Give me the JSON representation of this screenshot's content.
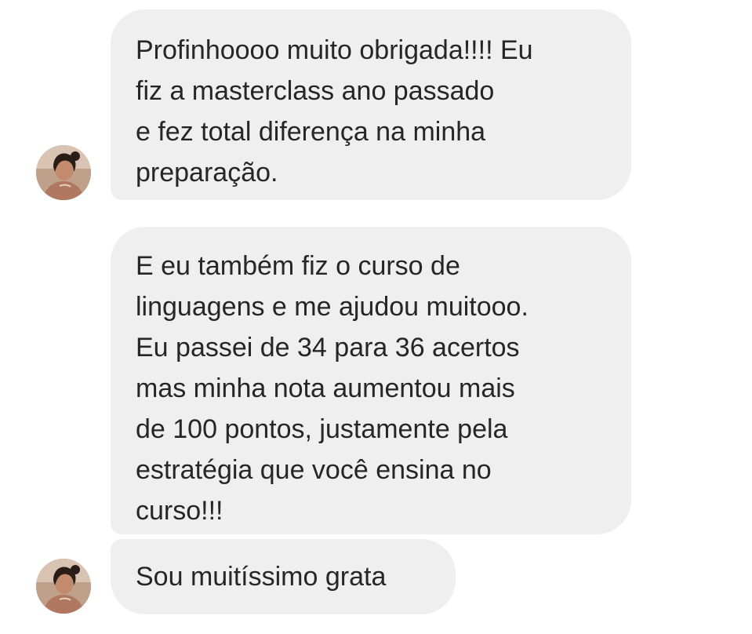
{
  "conversation": {
    "messages": [
      {
        "sender": "contact",
        "text": "Profinhoooo muito obrigada!!!! Eu\nfiz a masterclass ano passado\ne fez total diferença na minha\npreparação."
      },
      {
        "sender": "contact",
        "text": "E eu também fiz o curso de\nlinguagens e me ajudou muitooo.\nEu passei de 34 para 36 acertos\nmas minha nota aumentou mais\nde 100 pontos, justamente pela\nestratégia que você ensina no\ncurso!!!"
      },
      {
        "sender": "contact",
        "text": "Sou muitíssimo grata"
      }
    ]
  },
  "colors": {
    "bubble_background": "#efefef",
    "text": "#262626",
    "page_background": "#ffffff"
  },
  "icons": {
    "avatar": "contact-avatar-photo"
  }
}
